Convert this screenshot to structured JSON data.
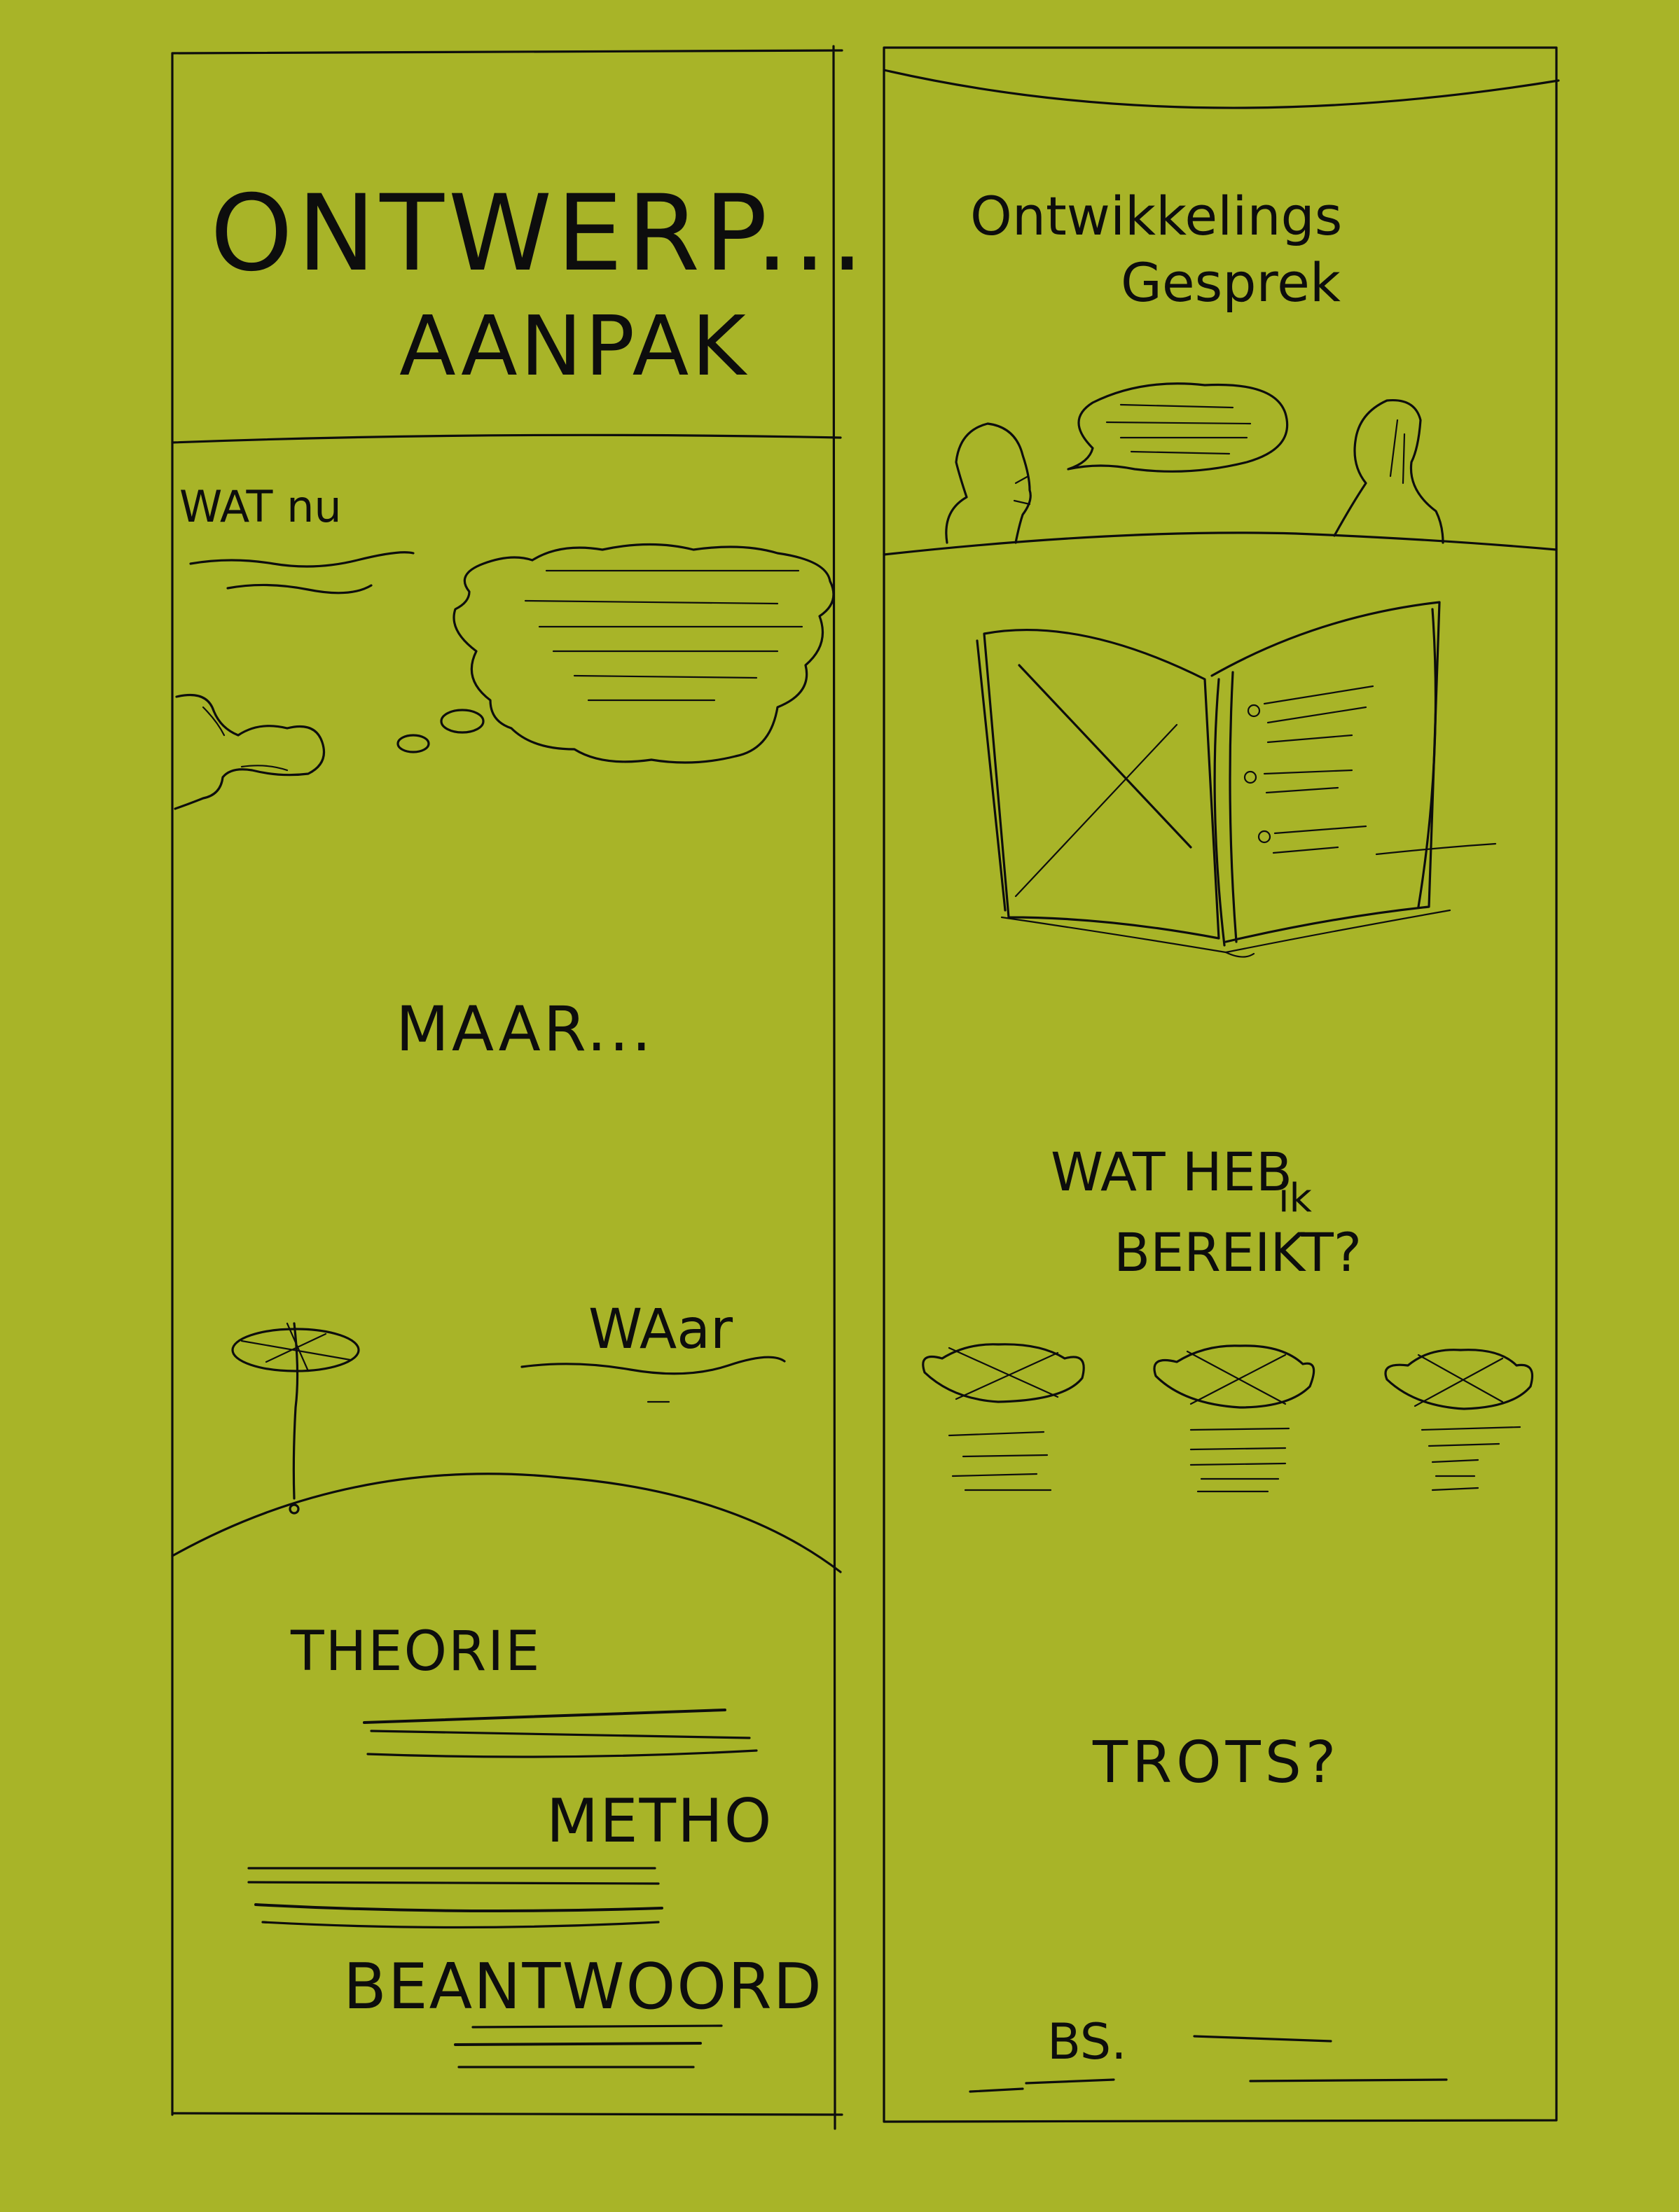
{
  "colors": {
    "background": "#a8b428",
    "ink": "#0d0d0d"
  },
  "left_panel": {
    "title_line1": "ONTWERP...",
    "title_line2": "AANPAK",
    "heading_wat": "WAT nu",
    "transition": "MAAR...",
    "heading_waar": "WAar",
    "theorie": "THEORIE",
    "metho": "METHO",
    "beantwoord": "BEANTWOORD"
  },
  "right_panel": {
    "title_line1": "Ontwikkelings",
    "title_line2": "Gesprek",
    "question_line1": "WAT HEB",
    "question_line2": "ik",
    "question_line3": "BEREIKT?",
    "trots": "TROTS?",
    "footer": "BS."
  },
  "icons": [
    "thinking-person-icon",
    "thought-cloud-icon",
    "tree-icon",
    "person-icon",
    "speech-bubble-icon",
    "open-book-icon",
    "image-placeholder-icon"
  ]
}
